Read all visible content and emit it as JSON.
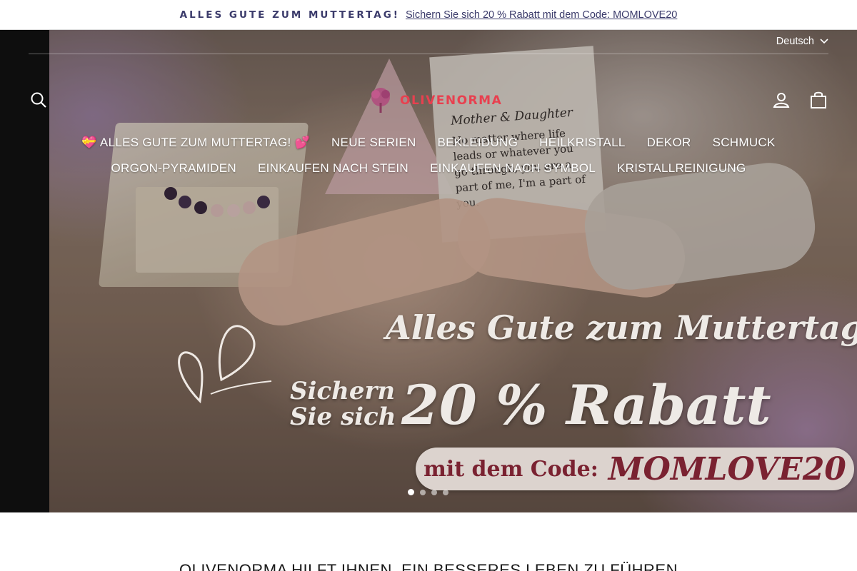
{
  "announcement": {
    "headline": "ALLES GUTE ZUM MUTTERTAG!",
    "offer_link": "Sichern Sie sich 20 % Rabatt mit dem Code: MOMLOVE20"
  },
  "header": {
    "language": "Deutsch",
    "logo_text": "OLIVENORMA",
    "icons": {
      "search": "search-icon",
      "account": "user-icon",
      "cart": "cart-icon",
      "language": "chevron-down-icon"
    }
  },
  "nav": {
    "row1": [
      "💝 ALLES GUTE ZUM MUTTERTAG! 💕",
      "NEUE SERIEN",
      "BEKLEIDUNG",
      "HEILKRISTALL",
      "DEKOR",
      "SCHMUCK"
    ],
    "row2": [
      "ORGON-PYRAMIDEN",
      "EINKAUFEN NACH STEIN",
      "EINKAUFEN NACH SYMBOL",
      "KRISTALLREINIGUNG"
    ]
  },
  "hero": {
    "card_title": "Mother & Daughter",
    "card_text": "No matter where life leads or whatever you go through, you are a part of me, I'm a part of you.",
    "title": "Alles Gute zum Muttertag!",
    "sichern_line1": "Sichern",
    "sichern_line2": "Sie sich",
    "discount": "20 % Rabatt",
    "code_label": "mit dem Code:",
    "code_value": "MOMLOVE20",
    "slide_count": 4,
    "active_slide": 1
  },
  "tagline": "OLIVENORMA HILFT IHNEN, EIN BESSERES LEBEN ZU FÜHREN",
  "colors": {
    "announcement_text": "#3b3b6b",
    "logo": "#e8404f",
    "code_text": "#7a2231",
    "code_pill": "#dcd3ce"
  }
}
